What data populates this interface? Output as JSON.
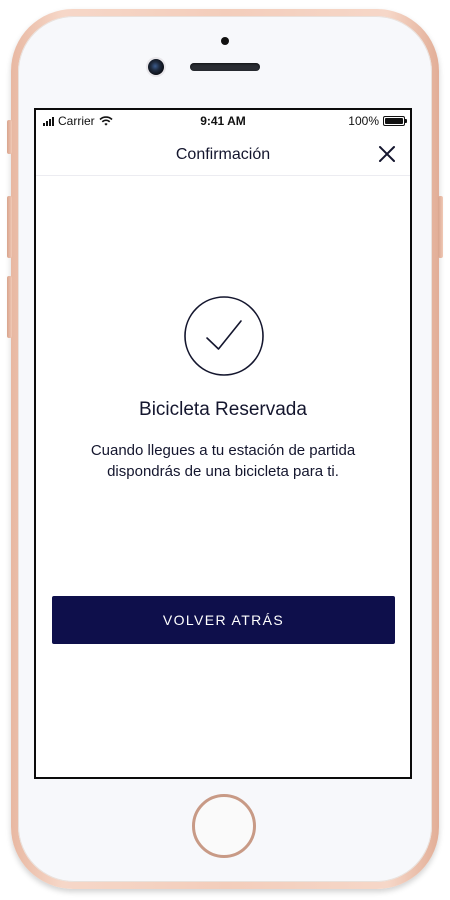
{
  "status_bar": {
    "carrier": "Carrier",
    "time": "9:41 AM",
    "battery": "100%",
    "battery_level": 1.0,
    "icons": [
      "signal-icon",
      "wifi-icon",
      "battery-icon"
    ]
  },
  "nav": {
    "title": "Confirmación",
    "close_icon": "close-icon"
  },
  "confirmation": {
    "icon": "check-circle-icon",
    "title": "Bicicleta Reservada",
    "message": "Cuando llegues a tu estación de partida dispondrás de una bicicleta para ti."
  },
  "actions": {
    "back_label": "VOLVER ATRÁS"
  },
  "colors": {
    "primary": "#0e0f4b",
    "text": "#14162e",
    "device_frame": "#f3cdbb"
  }
}
